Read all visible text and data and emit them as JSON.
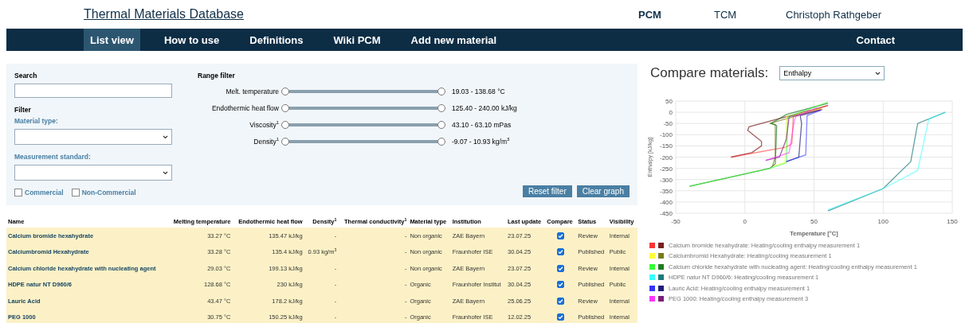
{
  "header": {
    "title": "Thermal Materials Database",
    "links": [
      {
        "label": "PCM",
        "selected": true
      },
      {
        "label": "TCM",
        "selected": false
      },
      {
        "label": "Christoph Rathgeber",
        "selected": false
      }
    ]
  },
  "nav": {
    "items": [
      {
        "label": "List view",
        "selected": true
      },
      {
        "label": "How to use",
        "selected": false
      },
      {
        "label": "Definitions",
        "selected": false
      },
      {
        "label": "Wiki PCM",
        "selected": false
      },
      {
        "label": "Add new material",
        "selected": false
      }
    ],
    "contact": "Contact"
  },
  "filters": {
    "search_label": "Search",
    "filter_label": "Filter",
    "material_type_label": "Material type:",
    "measurement_standard_label": "Measurement standard:",
    "checkboxes": [
      {
        "label": "Commercial",
        "checked": false
      },
      {
        "label": "Non-Commercial",
        "checked": false
      }
    ],
    "range_title": "Range filter",
    "ranges": [
      {
        "label": "Melt. temperature",
        "level": 1,
        "reading": "19.03 - 138.68 °C"
      },
      {
        "label": "Endothermic heat flow",
        "level": 1,
        "reading": "125.40 - 240.00 kJ/kg"
      },
      {
        "label": "Viscosity$^{1}$",
        "level": 1,
        "reading": "43.10 - 63.10 mPas"
      },
      {
        "label": "Density$^{1}$",
        "level": 1,
        "reading": "-9.07 - 10.93 kg/m$^{3}$"
      }
    ],
    "buttons": [
      "Reset filter",
      "Clear graph"
    ]
  },
  "table": {
    "columns": [
      "Name",
      "Melting temperature",
      "Endothermic heat flow",
      "Density$^{1}$",
      "Thermal conductivity$^{1}$",
      "Material type",
      "Institution",
      "Last update",
      "Compare",
      "Status",
      "Visibility"
    ],
    "rows": [
      {
        "name": "Calcium bromide hexahydrate",
        "melting": "33.27 °C",
        "heat_flow": "135.47 kJ/kg",
        "density": "-",
        "conductivity": "-",
        "type": "Non organic",
        "institution": "ZAE Bayern",
        "updated": "23.07.25",
        "compare": true,
        "status": "Review",
        "visibility": "Internal"
      },
      {
        "name": "Calciumbromid Hexahydrate",
        "melting": "33.28 °C",
        "heat_flow": "135.4 kJ/kg",
        "density": "0.93 kg/m$^{3}$",
        "conductivity": "-",
        "type": "Non organic",
        "institution": "Fraunhofer ISE",
        "updated": "30.04.25",
        "compare": true,
        "status": "Published",
        "visibility": "Public"
      },
      {
        "name": "Calcium chloride hexahydrate with nucleating agent",
        "melting": "29.03 °C",
        "heat_flow": "199.13 kJ/kg",
        "density": "-",
        "conductivity": "-",
        "type": "Non organic",
        "institution": "ZAE Bayern",
        "updated": "23.07.25",
        "compare": true,
        "status": "Review",
        "visibility": "Internal"
      },
      {
        "name": "HDPE natur NT D960/6",
        "melting": "128.68 °C",
        "heat_flow": "230 kJ/kg",
        "density": "-",
        "conductivity": "-",
        "type": "Organic",
        "institution": "Fraunhofer Institut",
        "updated": "30.04.25",
        "compare": true,
        "status": "Published",
        "visibility": "Public"
      },
      {
        "name": "Lauric Acid",
        "melting": "43.47 °C",
        "heat_flow": "178.2 kJ/kg",
        "density": "-",
        "conductivity": "-",
        "type": "Organic",
        "institution": "ZAE Bayern",
        "updated": "25.06.25",
        "compare": true,
        "status": "Review",
        "visibility": "Internal"
      },
      {
        "name": "PEG 1000",
        "melting": "30.75 °C",
        "heat_flow": "150.25 kJ/kg",
        "density": "-",
        "conductivity": "-",
        "type": "Organic",
        "institution": "Fraunhofer ISE",
        "updated": "12.02.25",
        "compare": true,
        "status": "Published",
        "visibility": "Internal"
      }
    ]
  },
  "compare": {
    "title": "Compare materials:",
    "select_value": "Enthalpy",
    "legend": [
      "Calcium bromide hexahydrate: Heating/cooling enthalpy measurement 1",
      "Calciumbromid Hexahydrate: Heating/cooling measurement 1",
      "Calcium chloride hexahydrate with nucleating agent: Heating/cooling enthalpy measurement 1",
      "HDPE natur NT D960/6: Heating/cooling measurement 1",
      "Lauric Acid: Heating/cooling enthalpy measurement 1",
      "PEG 1000: Heating/cooling enthalpy measurement 3"
    ],
    "chart_data": {
      "type": "line",
      "xlabel": "Temperature [°C]",
      "ylabel": "Enthalpy [kJ/kg]",
      "xlim": [
        -50,
        150
      ],
      "ylim": [
        -450,
        50
      ],
      "xticks": [
        -50,
        0,
        50,
        100,
        150
      ],
      "yticks": [
        -450,
        -400,
        -350,
        -300,
        -250,
        -200,
        -150,
        -100,
        -50,
        0,
        50
      ],
      "grid": true,
      "series": [
        {
          "color": "#ff3333",
          "x": [
            -10,
            30,
            34,
            35,
            60
          ],
          "values": [
            -200,
            -155,
            -140,
            -20,
            30
          ]
        },
        {
          "color": "#7a1f1f",
          "x": [
            60,
            3,
            2,
            12,
            12,
            5,
            -10
          ],
          "values": [
            30,
            -65,
            -80,
            -130,
            -150,
            -180,
            -200
          ]
        },
        {
          "color": "#ffff33",
          "x": [
            20,
            29,
            30,
            55
          ],
          "values": [
            -240,
            -225,
            -20,
            15
          ]
        },
        {
          "color": "#7a7a1f",
          "x": [
            55,
            18,
            22,
            22,
            20
          ],
          "values": [
            15,
            -50,
            -55,
            -200,
            -240
          ]
        },
        {
          "color": "#33ff33",
          "x": [
            -40,
            18,
            30,
            31,
            60
          ],
          "values": [
            -330,
            -250,
            -225,
            -20,
            45
          ]
        },
        {
          "color": "#1f7a1f",
          "x": [
            60,
            30,
            19,
            23,
            22,
            18,
            -40
          ],
          "values": [
            40,
            -10,
            -50,
            -60,
            -230,
            -250,
            -330
          ]
        },
        {
          "color": "#33ffff",
          "x": [
            60,
            100,
            125,
            133,
            145
          ],
          "values": [
            -435,
            -340,
            -260,
            -30,
            0
          ]
        },
        {
          "color": "#1f7a7a",
          "x": [
            145,
            125,
            120,
            100,
            60
          ],
          "values": [
            0,
            -50,
            -220,
            -340,
            -440
          ]
        },
        {
          "color": "#3333ff",
          "x": [
            30,
            44,
            45,
            55
          ],
          "values": [
            -220,
            -190,
            -15,
            10
          ]
        },
        {
          "color": "#1f1f7a",
          "x": [
            55,
            40,
            41,
            39,
            30
          ],
          "values": [
            10,
            -15,
            -50,
            -200,
            -220
          ]
        },
        {
          "color": "#ff33ff",
          "x": [
            15,
            32,
            36,
            37,
            52
          ],
          "values": [
            -215,
            -180,
            -30,
            -20,
            20
          ]
        },
        {
          "color": "#7a1f7a",
          "x": [
            56,
            32,
            30,
            25,
            15
          ],
          "values": [
            12,
            -20,
            -120,
            -200,
            -215
          ]
        }
      ]
    }
  }
}
